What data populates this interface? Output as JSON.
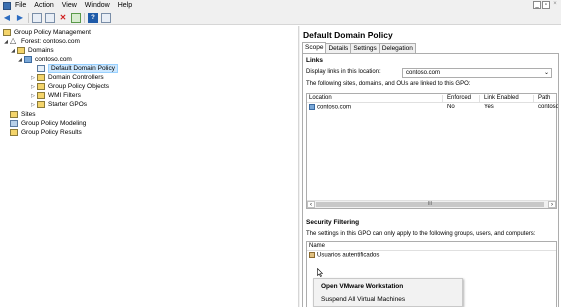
{
  "menubar": {
    "items": [
      "File",
      "Action",
      "View",
      "Window",
      "Help"
    ]
  },
  "toolbar": {
    "icons": [
      "back-arrow-icon",
      "forward-arrow-icon",
      "folder-icon",
      "console-tree-icon",
      "delete-icon",
      "refresh-icon",
      "help-icon",
      "properties-icon"
    ]
  },
  "tree": {
    "root": "Group Policy Management",
    "forest": "Forest: contoso.com",
    "domains": "Domains",
    "domain": "contoso.com",
    "items": [
      "Default Domain Policy",
      "Domain Controllers",
      "Group Policy Objects",
      "WMI Filters",
      "Starter GPOs"
    ],
    "sites": "Sites",
    "modeling": "Group Policy Modeling",
    "results": "Group Policy Results"
  },
  "detail": {
    "title": "Default Domain Policy",
    "tabs": [
      "Scope",
      "Details",
      "Settings",
      "Delegation"
    ],
    "links": {
      "heading": "Links",
      "location_label": "Display links in this location:",
      "location_value": "contoso.com",
      "linked_text": "The following sites, domains, and OUs are linked to this GPO:",
      "columns": [
        "Location",
        "Enforced",
        "Link Enabled",
        "Path"
      ],
      "rows": [
        {
          "location": "contoso.com",
          "enforced": "No",
          "link_enabled": "Yes",
          "path": "contoso"
        }
      ]
    },
    "security": {
      "heading": "Security Filtering",
      "description": "The settings in this GPO can only apply to the following groups, users, and computers:",
      "column": "Name",
      "rows": [
        "Usuarios autentificados"
      ]
    }
  },
  "context_menu": {
    "items": [
      "Open VMware Workstation",
      "Suspend All Virtual Machines"
    ]
  }
}
